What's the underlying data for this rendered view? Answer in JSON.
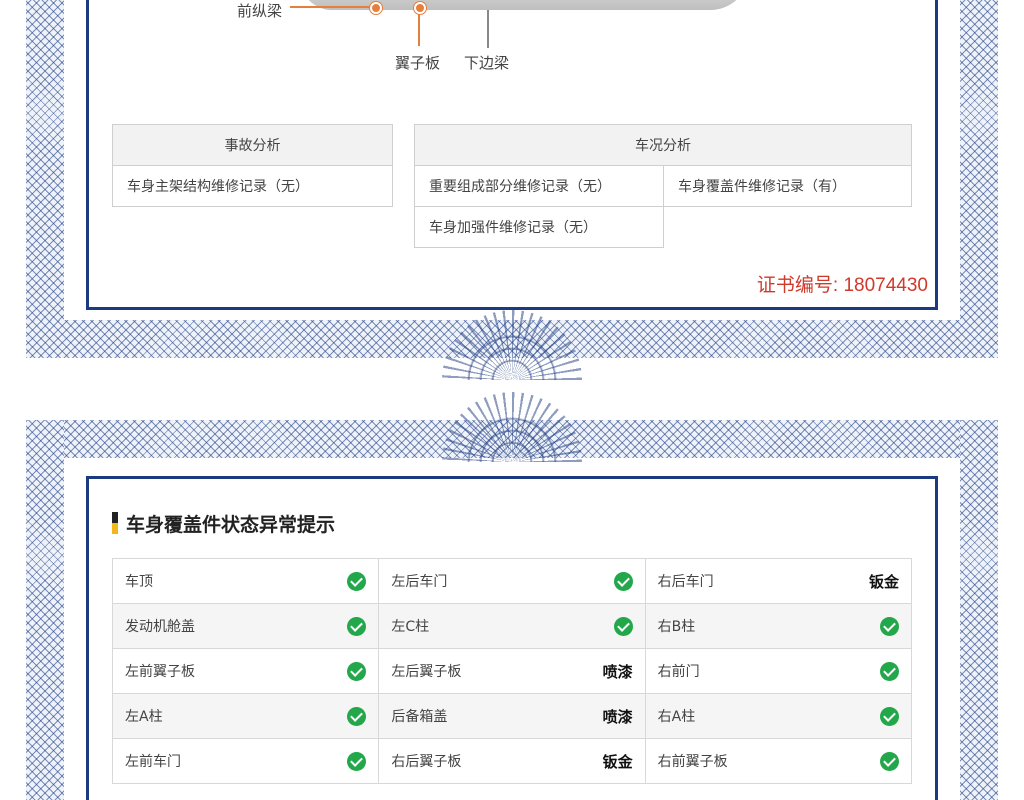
{
  "diagram": {
    "labels": [
      "前纵梁",
      "翼子板",
      "下边梁"
    ]
  },
  "accident_table": {
    "header": "事故分析",
    "rows": [
      "车身主架结构维修记录（无）"
    ]
  },
  "condition_table": {
    "header": "车况分析",
    "cells": [
      "重要组成部分维修记录（无）",
      "车身覆盖件维修记录（有）",
      "车身加强件维修记录（无）"
    ]
  },
  "certificate": {
    "label": "证书编号: 18074430"
  },
  "status_section": {
    "title": "车身覆盖件状态异常提示",
    "rows": [
      [
        {
          "name": "车顶",
          "status": "ok"
        },
        {
          "name": "左后车门",
          "status": "ok"
        },
        {
          "name": "右后车门",
          "status": "钣金"
        }
      ],
      [
        {
          "name": "发动机舱盖",
          "status": "ok"
        },
        {
          "name": "左C柱",
          "status": "ok"
        },
        {
          "name": "右B柱",
          "status": "ok"
        }
      ],
      [
        {
          "name": "左前翼子板",
          "status": "ok"
        },
        {
          "name": "左后翼子板",
          "status": "喷漆"
        },
        {
          "name": "右前门",
          "status": "ok"
        }
      ],
      [
        {
          "name": "左A柱",
          "status": "ok"
        },
        {
          "name": "后备箱盖",
          "status": "喷漆"
        },
        {
          "name": "右A柱",
          "status": "ok"
        }
      ],
      [
        {
          "name": "左前车门",
          "status": "ok"
        },
        {
          "name": "右后翼子板",
          "status": "钣金"
        },
        {
          "name": "右前翼子板",
          "status": "ok"
        }
      ]
    ],
    "ok_icon": "check-circle-icon",
    "ok_color": "#22a84a"
  },
  "colors": {
    "frame": "#1c3a80",
    "accent": "#d0392b",
    "leader": "#e67e3c"
  }
}
